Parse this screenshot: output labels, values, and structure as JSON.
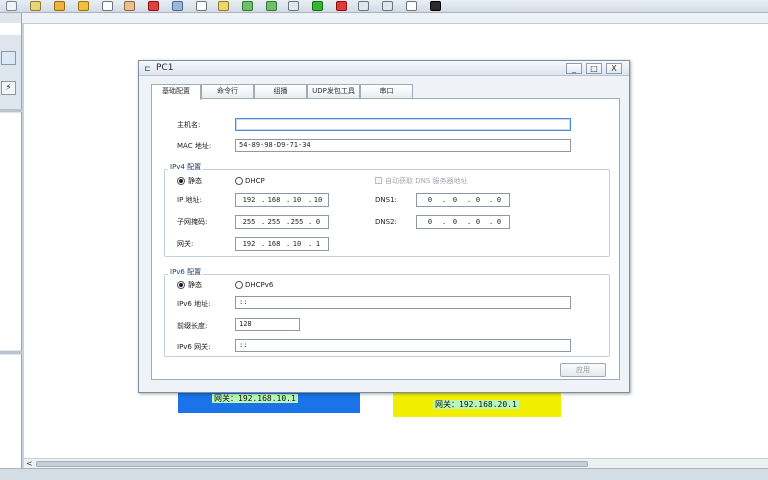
{
  "toolbar": {
    "icons": [
      "new-icon",
      "save-icon",
      "undo-icon",
      "redo-icon",
      "select-icon",
      "hand-icon",
      "delete-icon",
      "zoom-icon",
      "text-icon",
      "rect-icon",
      "zoom-in-icon",
      "zoom-out-icon",
      "fit-icon",
      "start-icon",
      "stop-icon",
      "capture-icon",
      "topology-icon",
      "window-icon",
      "screenshot-icon"
    ]
  },
  "colors": {
    "blue_box": "#1a73e8",
    "yellow_box": "#f2ee00",
    "label_bg": "#b8f7b8",
    "focus": "#4d8ad6"
  },
  "background": {
    "pc1_gateway": "网关：192.168.10.1",
    "pc2_gateway": "网关：192.168.20.1"
  },
  "scrollbar": {
    "left_arrow": "<"
  },
  "dialog": {
    "title": "PC1",
    "buttons": {
      "minimize": "_",
      "maximize": "□",
      "close": "X"
    },
    "tabs": [
      "基础配置",
      "命令行",
      "组播",
      "UDP发包工具",
      "串口"
    ],
    "basic": {
      "hostname_label": "主机名:",
      "hostname_value": "",
      "mac_label": "MAC 地址:",
      "mac_value": "54-89-98-D9-71-34",
      "ipv4_group": "IPv4 配置",
      "static_label": "静态",
      "dhcp_label": "DHCP",
      "auto_dns_label": "自动获取 DNS 服务器地址",
      "ip_label": "IP 地址:",
      "ip_value": [
        "192",
        "168",
        "10",
        "10"
      ],
      "mask_label": "子网掩码:",
      "mask_value": [
        "255",
        "255",
        "255",
        "0"
      ],
      "gateway_label": "网关:",
      "gateway_value": [
        "192",
        "168",
        "10",
        "1"
      ],
      "dns1_label": "DNS1:",
      "dns1_value": [
        "0",
        "0",
        "0",
        "0"
      ],
      "dns2_label": "DNS2:",
      "dns2_value": [
        "0",
        "0",
        "0",
        "0"
      ],
      "ipv6_group": "IPv6 配置",
      "static6_label": "静态",
      "dhcpv6_label": "DHCPv6",
      "ipv6_addr_label": "IPv6 地址:",
      "ipv6_addr_value": "::",
      "prefix_label": "前缀长度:",
      "prefix_value": "128",
      "ipv6_gw_label": "IPv6 网关:",
      "ipv6_gw_value": "::",
      "apply_label": "应用"
    }
  }
}
